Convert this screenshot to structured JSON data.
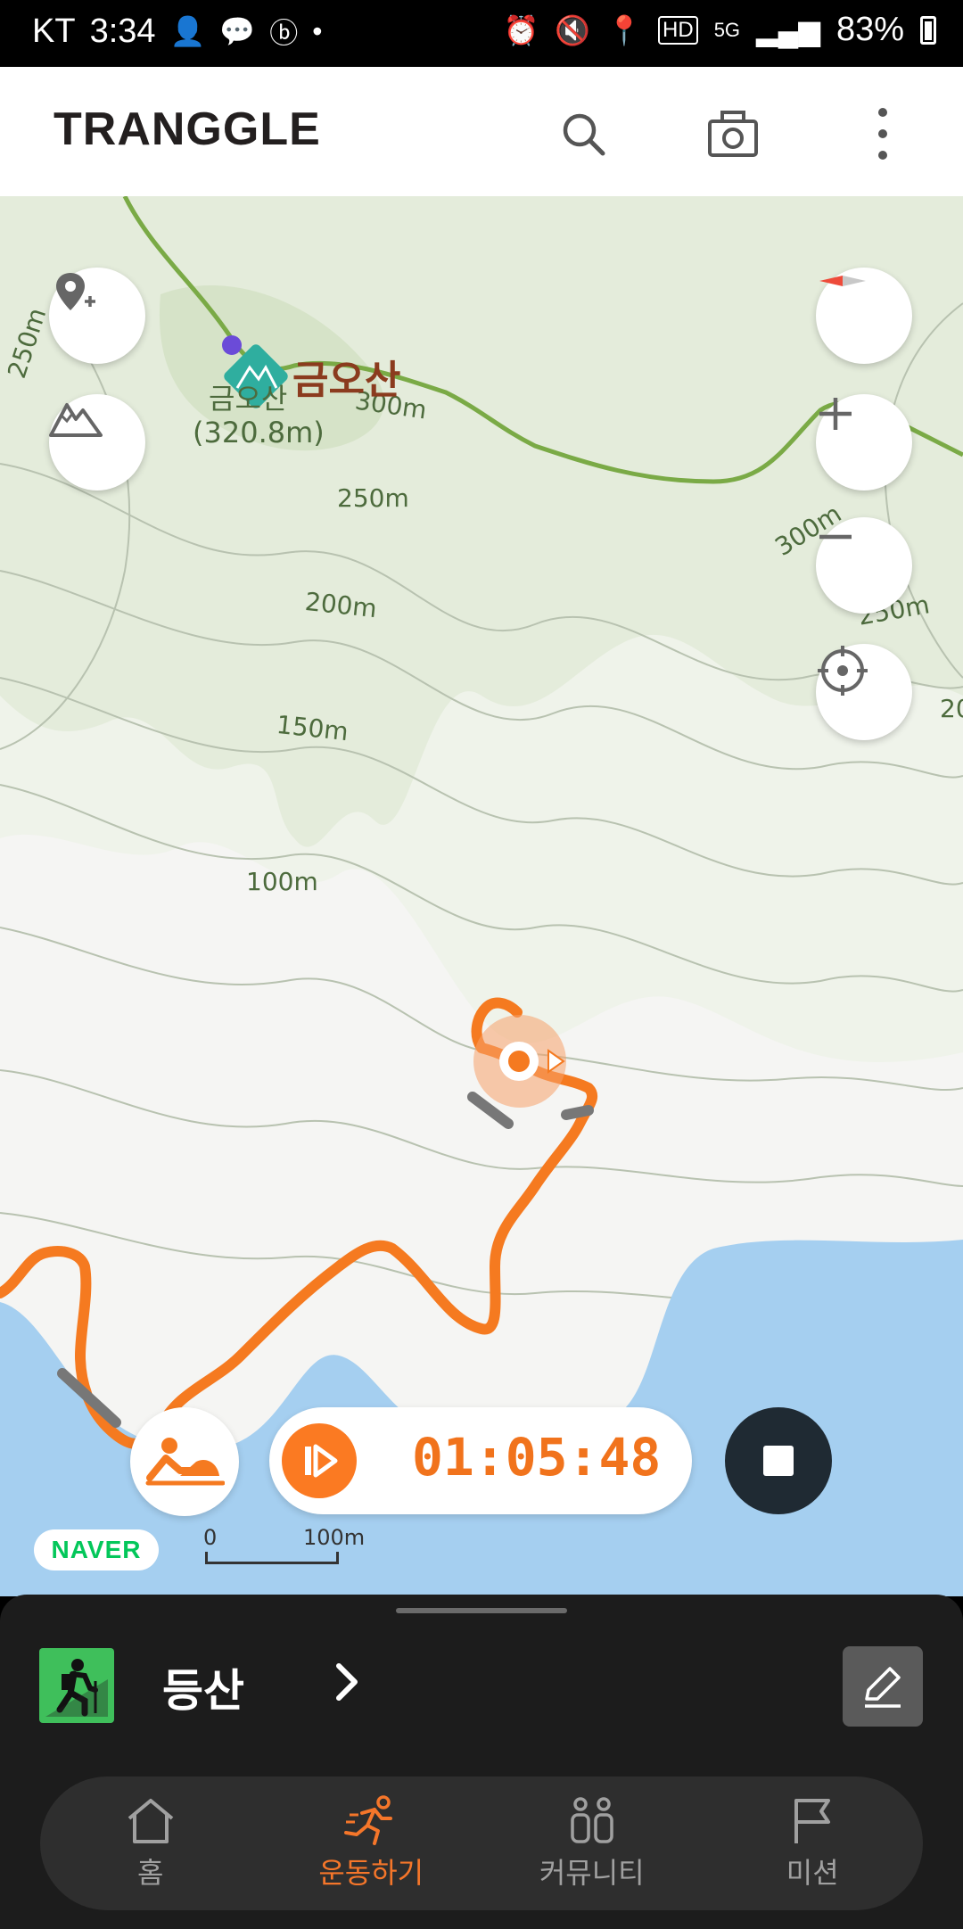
{
  "status_bar": {
    "carrier": "KT",
    "time": "3:34",
    "network": "5G",
    "battery": "83%"
  },
  "header": {
    "logo": "TRANGGLE",
    "icons": [
      "search-icon",
      "camera-icon",
      "more-vertical-icon"
    ]
  },
  "map": {
    "peak": {
      "name": "금오산",
      "sub_name": "금오산",
      "elevation": "(320.8m)"
    },
    "contours": [
      "250m",
      "300m",
      "250m",
      "200m",
      "150m",
      "100m",
      "300m",
      "250m",
      "20"
    ],
    "attribution": "NAVER",
    "scale": {
      "start": "0",
      "end": "100m"
    }
  },
  "controls": {
    "timer": "01:05:48",
    "accent": "#fb7a22"
  },
  "sheet": {
    "activity": "등산"
  },
  "tabs": [
    {
      "label": "홈",
      "icon": "home-icon",
      "active": false
    },
    {
      "label": "운동하기",
      "icon": "running-icon",
      "active": true
    },
    {
      "label": "커뮤니티",
      "icon": "community-icon",
      "active": false
    },
    {
      "label": "미션",
      "icon": "flag-icon",
      "active": false
    }
  ]
}
